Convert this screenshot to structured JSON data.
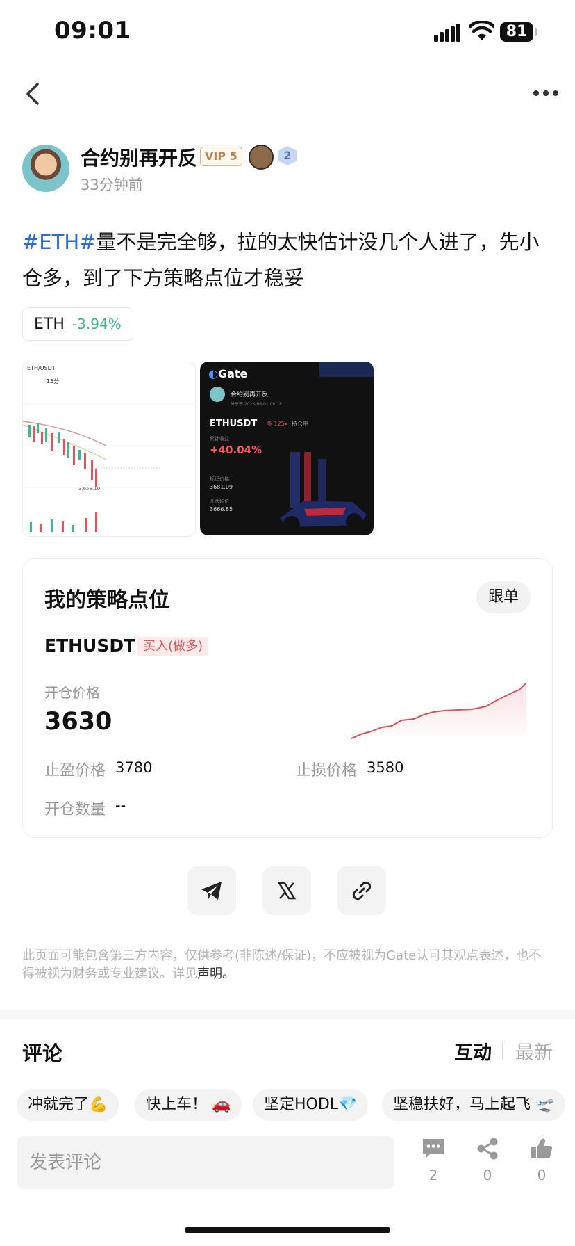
{
  "status_bar": {
    "time": "09:01",
    "battery": "81"
  },
  "author": {
    "name": "合约别再开反",
    "vip": "VIP 5",
    "level": "2",
    "time_ago": "33分钟前"
  },
  "post": {
    "hashtag": "#ETH#",
    "text": "量不是完全够，拉的太快估计没几个人进了，先小仓多，到了下方策略点位才稳妥"
  },
  "coin_chip": {
    "symbol": "ETH",
    "change": "-3.94%"
  },
  "image1": {
    "symbol": "ETH/USDT",
    "tab": "15分",
    "price_low": "3,658.10"
  },
  "image2": {
    "brand": "Gate",
    "user": "合约别再开反",
    "shared": "分享于 2025-06-01 08:18",
    "pair": "ETHUSDT",
    "side": "多 125x",
    "status": "持仓中",
    "pnl_label": "累计收益",
    "pnl": "+40.04%",
    "mark_label": "标记价格",
    "mark": "3681.09",
    "entry_label": "开仓均价",
    "entry": "3666.85"
  },
  "strategy": {
    "title": "我的策略点位",
    "follow": "跟单",
    "pair": "ETHUSDT",
    "side": "买入(做多)",
    "open_label": "开仓价格",
    "open_value": "3630",
    "tp_label": "止盈价格",
    "tp_value": "3780",
    "sl_label": "止损价格",
    "sl_value": "3580",
    "qty_label": "开仓数量",
    "qty_value": "--"
  },
  "share": [
    "telegram-icon",
    "x-icon",
    "link-icon"
  ],
  "disclaimer": {
    "text": "此页面可能包含第三方内容，仅供参考(非陈述/保证)，不应被视为Gate认可其观点表述，也不得被视为财务或专业建议。详见",
    "link": "声明。"
  },
  "comments": {
    "title": "评论",
    "tab_active": "互动",
    "tab_new": "最新",
    "quick": [
      "冲就完了💪",
      "快上车！ 🚗",
      "坚定HODL💎",
      "坚稳扶好，马上起飞 🛫"
    ],
    "input_placeholder": "发表评论",
    "counts": {
      "comment": "2",
      "share": "0",
      "like": "0"
    }
  },
  "colors": {
    "accent_blue": "#2b6cd8",
    "down_green": "#3fb68b",
    "long_red": "#e0575b"
  }
}
